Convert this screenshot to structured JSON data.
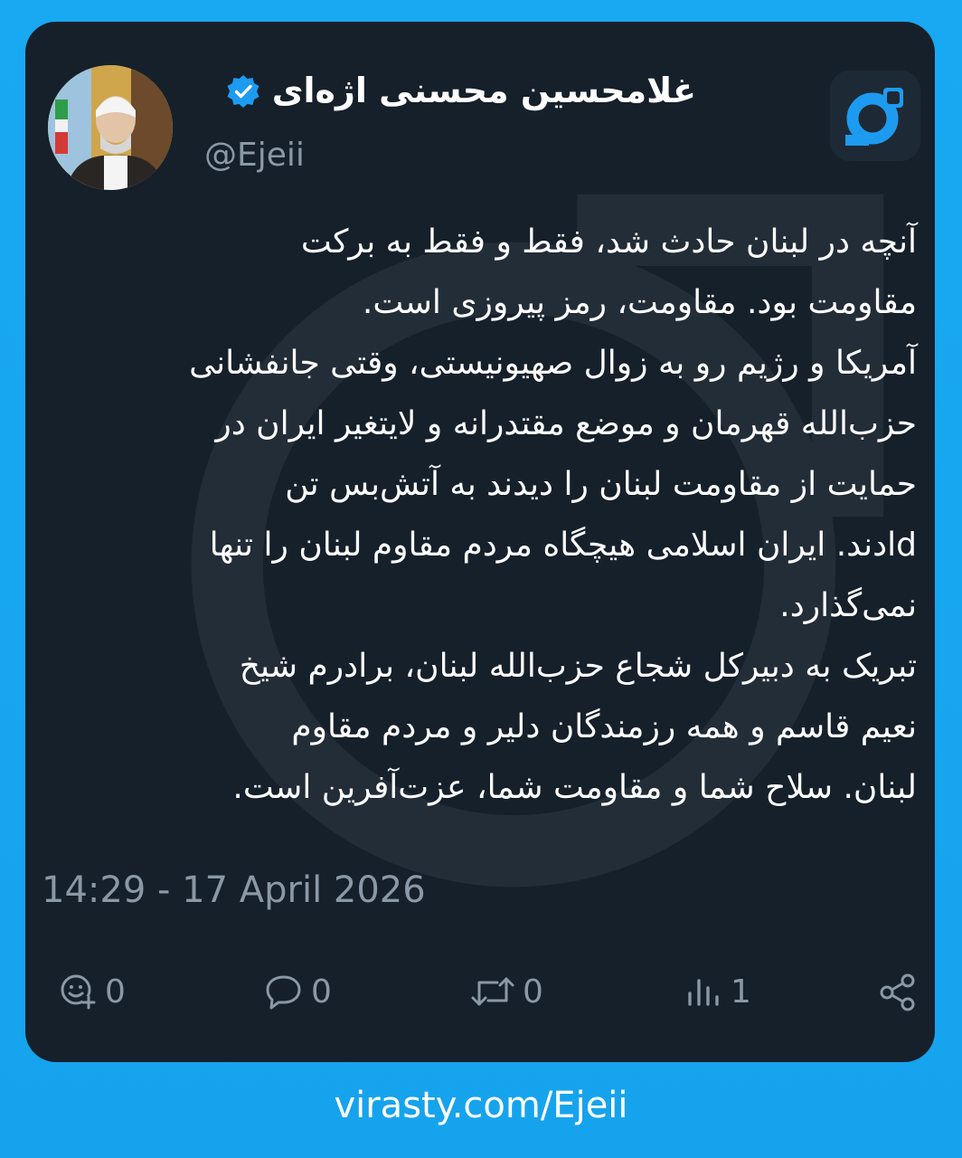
{
  "author": {
    "display_name": "غلامحسین محسنی اژه‌ای",
    "handle": "@Ejeii",
    "verified": true,
    "avatar_icon": "profile-photo"
  },
  "tweet": {
    "text": "آنچه در لبنان حادث شد، فقط و فقط به برکت\nمقاومت بود. مقاومت، رمز پیروزی است.\nآمریکا و رژیم رو به زوال صهیونیستی، وقتی جانفشانی\nحزب‌الله قهرمان و موضع مقتدرانه و لایتغیر ایران در\nحمایت از مقاومت لبنان را دیدند به آتش‌بس تن\ndادند. ایران اسلامی هیچگاه مردم مقاوم لبنان را تنها\nنمی‌گذارد.\nتبریک به دبیرکل شجاع حزب‌الله لبنان، برادرم شیخ\nنعیم قاسم و همه رزمندگان دلیر و مردم مقاوم\nلبنان. سلاح شما و مقاومت شما، عزت‌آفرین است.",
    "timestamp": "14:29 - 17 April 2026"
  },
  "actions": {
    "reactions": {
      "icon": "reaction-add-icon",
      "count": "0"
    },
    "replies": {
      "icon": "reply-icon",
      "count": "0"
    },
    "reposts": {
      "icon": "repost-icon",
      "count": "0"
    },
    "views": {
      "icon": "views-icon",
      "count": "1"
    },
    "share": {
      "icon": "share-icon"
    }
  },
  "footer": {
    "link": "virasty.com/Ejeii"
  },
  "colors": {
    "background": "#18a9f2",
    "card": "#15202b",
    "text": "#ffffff",
    "muted": "#8b98a5",
    "accent": "#1d9bf0"
  }
}
